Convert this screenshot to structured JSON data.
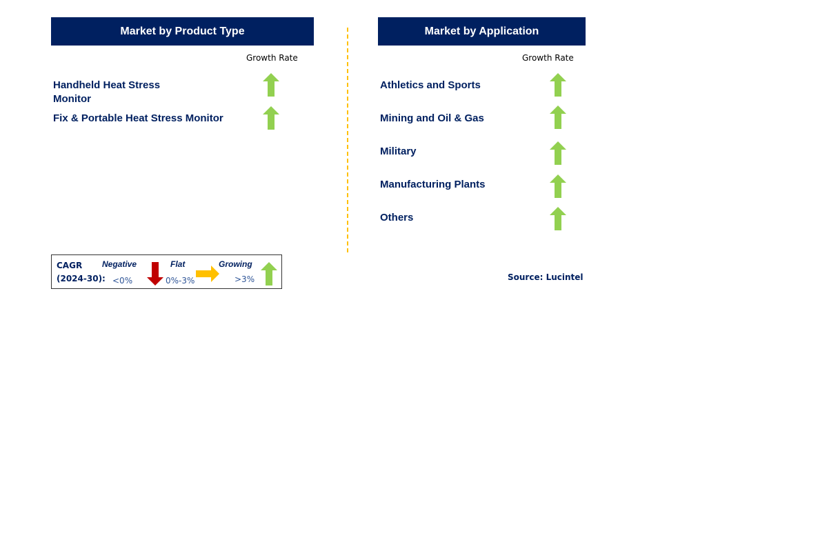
{
  "product_type": {
    "title": "Market by Product Type",
    "growth_rate_label": "Growth Rate",
    "items": [
      {
        "label_line1": "Handheld Heat Stress",
        "label_line2": "Monitor",
        "trend": "growing"
      },
      {
        "label_line1": "Fix & Portable Heat Stress Monitor",
        "label_line2": "",
        "trend": "growing"
      }
    ]
  },
  "application": {
    "title": "Market by Application",
    "growth_rate_label": "Growth Rate",
    "items": [
      {
        "label": "Athletics and Sports",
        "trend": "growing"
      },
      {
        "label": "Mining and Oil & Gas",
        "trend": "growing"
      },
      {
        "label": "Military",
        "trend": "growing"
      },
      {
        "label": "Manufacturing Plants",
        "trend": "growing"
      },
      {
        "label": "Others",
        "trend": "growing"
      }
    ]
  },
  "legend": {
    "cagr_label": "CAGR",
    "period_label": "(2024-30):",
    "negative": {
      "label": "Negative",
      "range": "<0%",
      "icon": "arrow-down-icon"
    },
    "flat": {
      "label": "Flat",
      "range": "0%-3%",
      "icon": "arrow-right-icon"
    },
    "growing": {
      "label": "Growing",
      "range": ">3%",
      "icon": "arrow-up-icon"
    }
  },
  "source": "Source: Lucintel",
  "colors": {
    "header_bg": "#002060",
    "text": "#002060",
    "growing": "#92D050",
    "negative": "#C00000",
    "flat": "#FFC000",
    "divider": "#FFC000"
  }
}
